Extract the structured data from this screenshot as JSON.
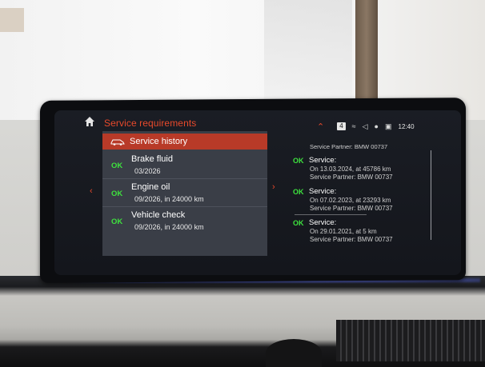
{
  "header": {
    "title": "Service requirements",
    "badge": "4",
    "time": "12:40"
  },
  "submenu": {
    "label": "Service history"
  },
  "items": [
    {
      "status": "OK",
      "name": "Brake fluid",
      "detail": "03/2026"
    },
    {
      "status": "OK",
      "name": "Engine oil",
      "detail": "09/2026, in 24000 km"
    },
    {
      "status": "OK",
      "name": "Vehicle check",
      "detail": "09/2026, in 24000 km"
    }
  ],
  "history": {
    "partial_top": "Service Partner: BMW 00737",
    "entries": [
      {
        "status": "OK",
        "label": "Service:",
        "line1": "On 13.03.2024, at 45786 km",
        "line2": "Service Partner: BMW 00737"
      },
      {
        "status": "OK",
        "label": "Service:",
        "line1": "On 07.02.2023, at 23293 km",
        "line2": "Service Partner: BMW 00737"
      },
      {
        "status": "OK",
        "label": "Service:",
        "line1": "On 29.01.2021, at 5 km",
        "line2": "Service Partner: BMW 00737"
      }
    ]
  },
  "icons": {
    "home": "home-icon",
    "collapse": "chevron-up-icon",
    "signal": "signal-icon",
    "volume": "speaker-icon",
    "mic": "microphone-icon",
    "profile": "profile-icon",
    "car": "car-icon",
    "nav_left": "chevron-left-icon",
    "nav_right": "chevron-right-icon"
  },
  "colors": {
    "accent": "#e8492b",
    "ok": "#3ee23e",
    "panel": "#3a3e47",
    "submenu_bg": "#b83a28"
  }
}
